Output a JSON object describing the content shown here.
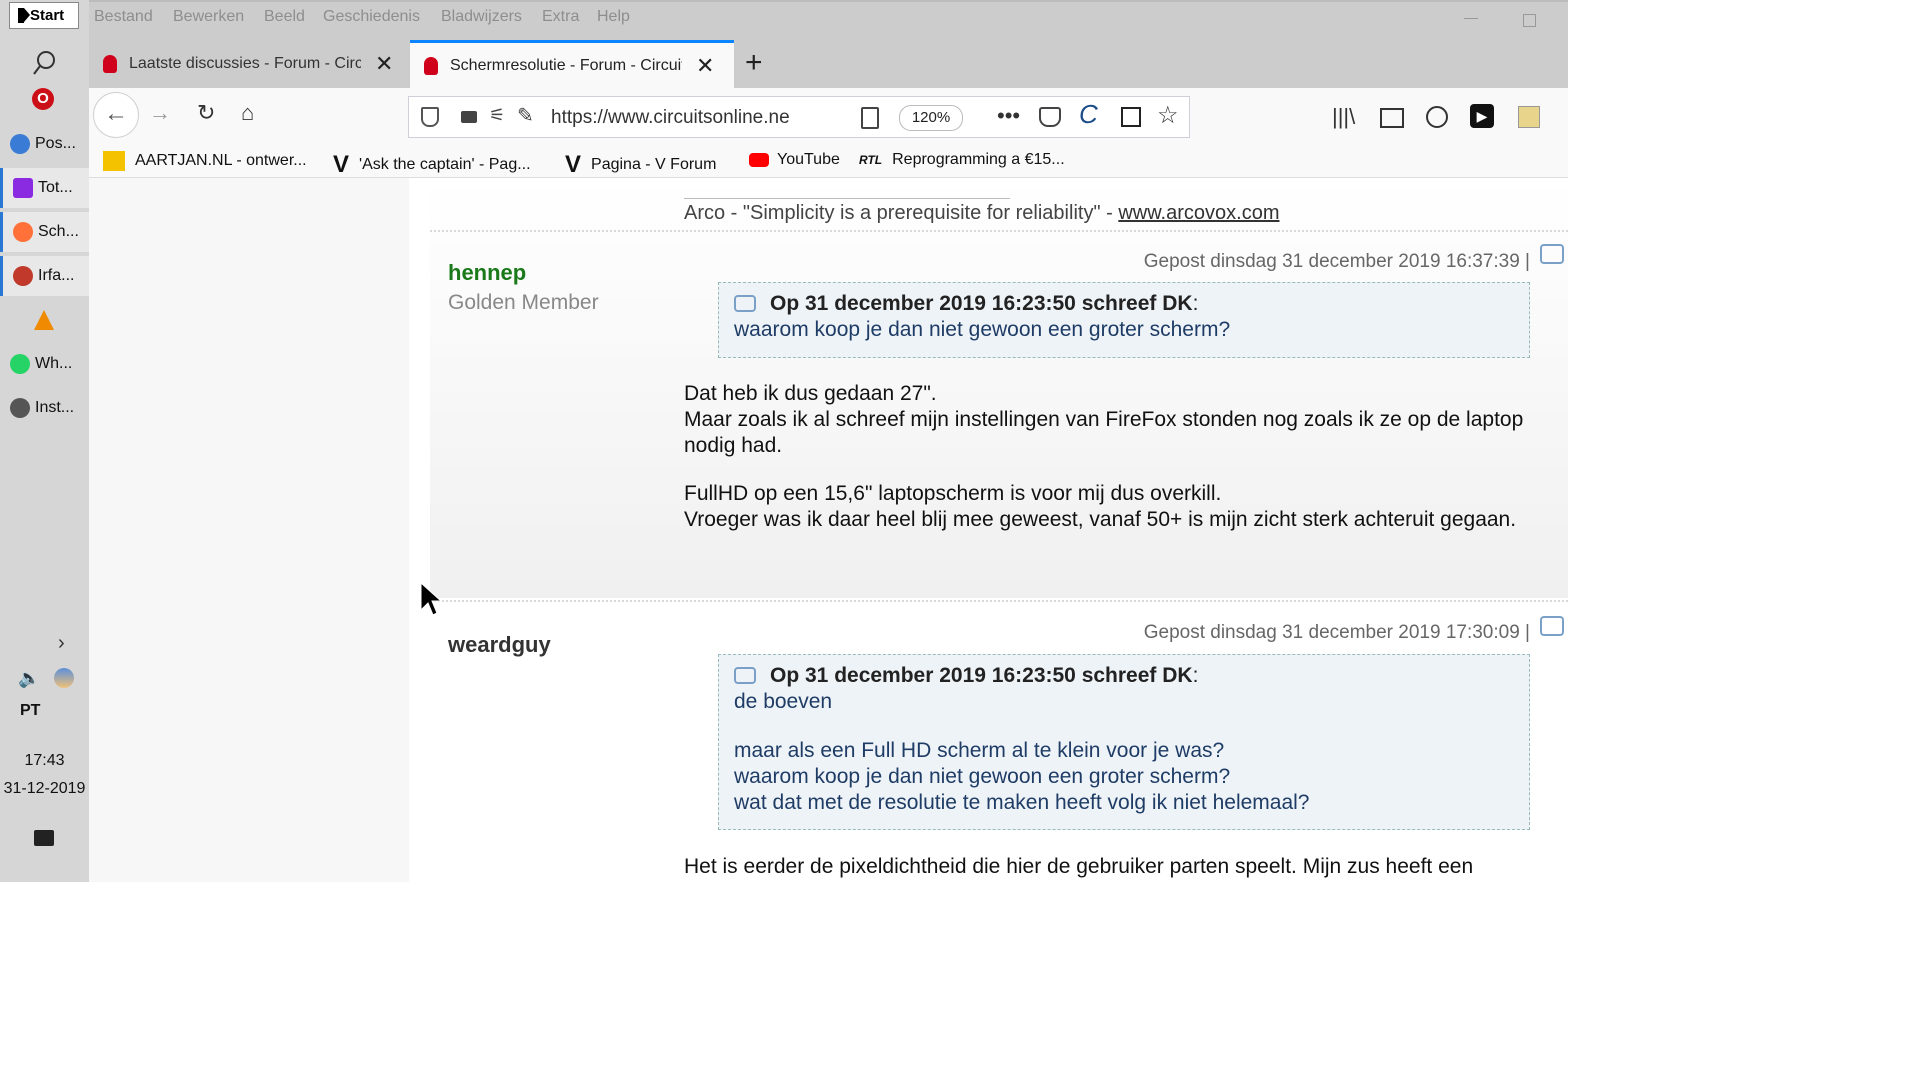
{
  "taskbar": {
    "start_label": "Start",
    "items": [
      {
        "label": "Pos...",
        "color": "#3a7bd5"
      },
      {
        "label": "Tot...",
        "color": "#8a2be2"
      },
      {
        "label": "Sch...",
        "color": "#ff7139"
      },
      {
        "label": "Irfa...",
        "color": "#c0392b"
      },
      {
        "label": "Wh...",
        "color": "#25d366"
      },
      {
        "label": "Inst...",
        "color": "#555555"
      }
    ],
    "time": "17:43",
    "date": "31-12-2019",
    "lang": "PT"
  },
  "menu": [
    "Bestand",
    "Bewerken",
    "Beeld",
    "Geschiedenis",
    "Bladwijzers",
    "Extra",
    "Help"
  ],
  "tabs": [
    {
      "title": "Laatste discussies - Forum - Circuits Online"
    },
    {
      "title": "Schermresolutie - Forum - Circuits Online"
    }
  ],
  "url": "https://www.circuitsonline.ne",
  "zoom": "120%",
  "bookmarks": [
    {
      "label": "AARTJAN.NL - ontwer..."
    },
    {
      "label": "'Ask the captain' - Pag..."
    },
    {
      "label": "Pagina - V Forum"
    },
    {
      "label": "YouTube"
    },
    {
      "label": "Reprogramming a €15..."
    }
  ],
  "signature": {
    "text": "Arco - \"Simplicity is a prerequisite for reliability\" - ",
    "link": "www.arcovox.com"
  },
  "posts": [
    {
      "author": "hennep",
      "rank": "Golden Member",
      "date": "Gepost dinsdag 31 december 2019 16:37:39 |",
      "quote_header": "Op 31 december 2019 16:23:50 schreef DK",
      "quote_lines": [
        "waarom koop je dan niet gewoon een groter scherm?"
      ],
      "paragraphs": [
        "Dat heb ik dus gedaan 27\".",
        "Maar zoals ik al schreef mijn instellingen van FireFox stonden nog zoals ik ze op de laptop nodig had.",
        "FullHD op een 15,6\" laptopscherm is voor mij dus overkill.",
        "Vroeger was ik daar heel blij mee geweest, vanaf 50+ is mijn zicht sterk achteruit gegaan."
      ]
    },
    {
      "author": "weardguy",
      "date": "Gepost dinsdag 31 december 2019 17:30:09 |",
      "quote_header": "Op 31 december 2019 16:23:50 schreef DK",
      "quote_lines": [
        "de boeven",
        "",
        "maar als een Full HD scherm al te klein voor je was?",
        "waarom koop je dan niet gewoon een groter scherm?",
        "wat dat met de resolutie te maken heeft volg ik niet helemaal?"
      ],
      "paragraphs": [
        "Het is eerder de pixeldichtheid die hier de gebruiker parten speelt. Mijn zus heeft een"
      ]
    }
  ],
  "colors": {
    "accent": "#0a84ff",
    "author_green": "#1a7a1a",
    "quote_text": "#1f3c66"
  }
}
